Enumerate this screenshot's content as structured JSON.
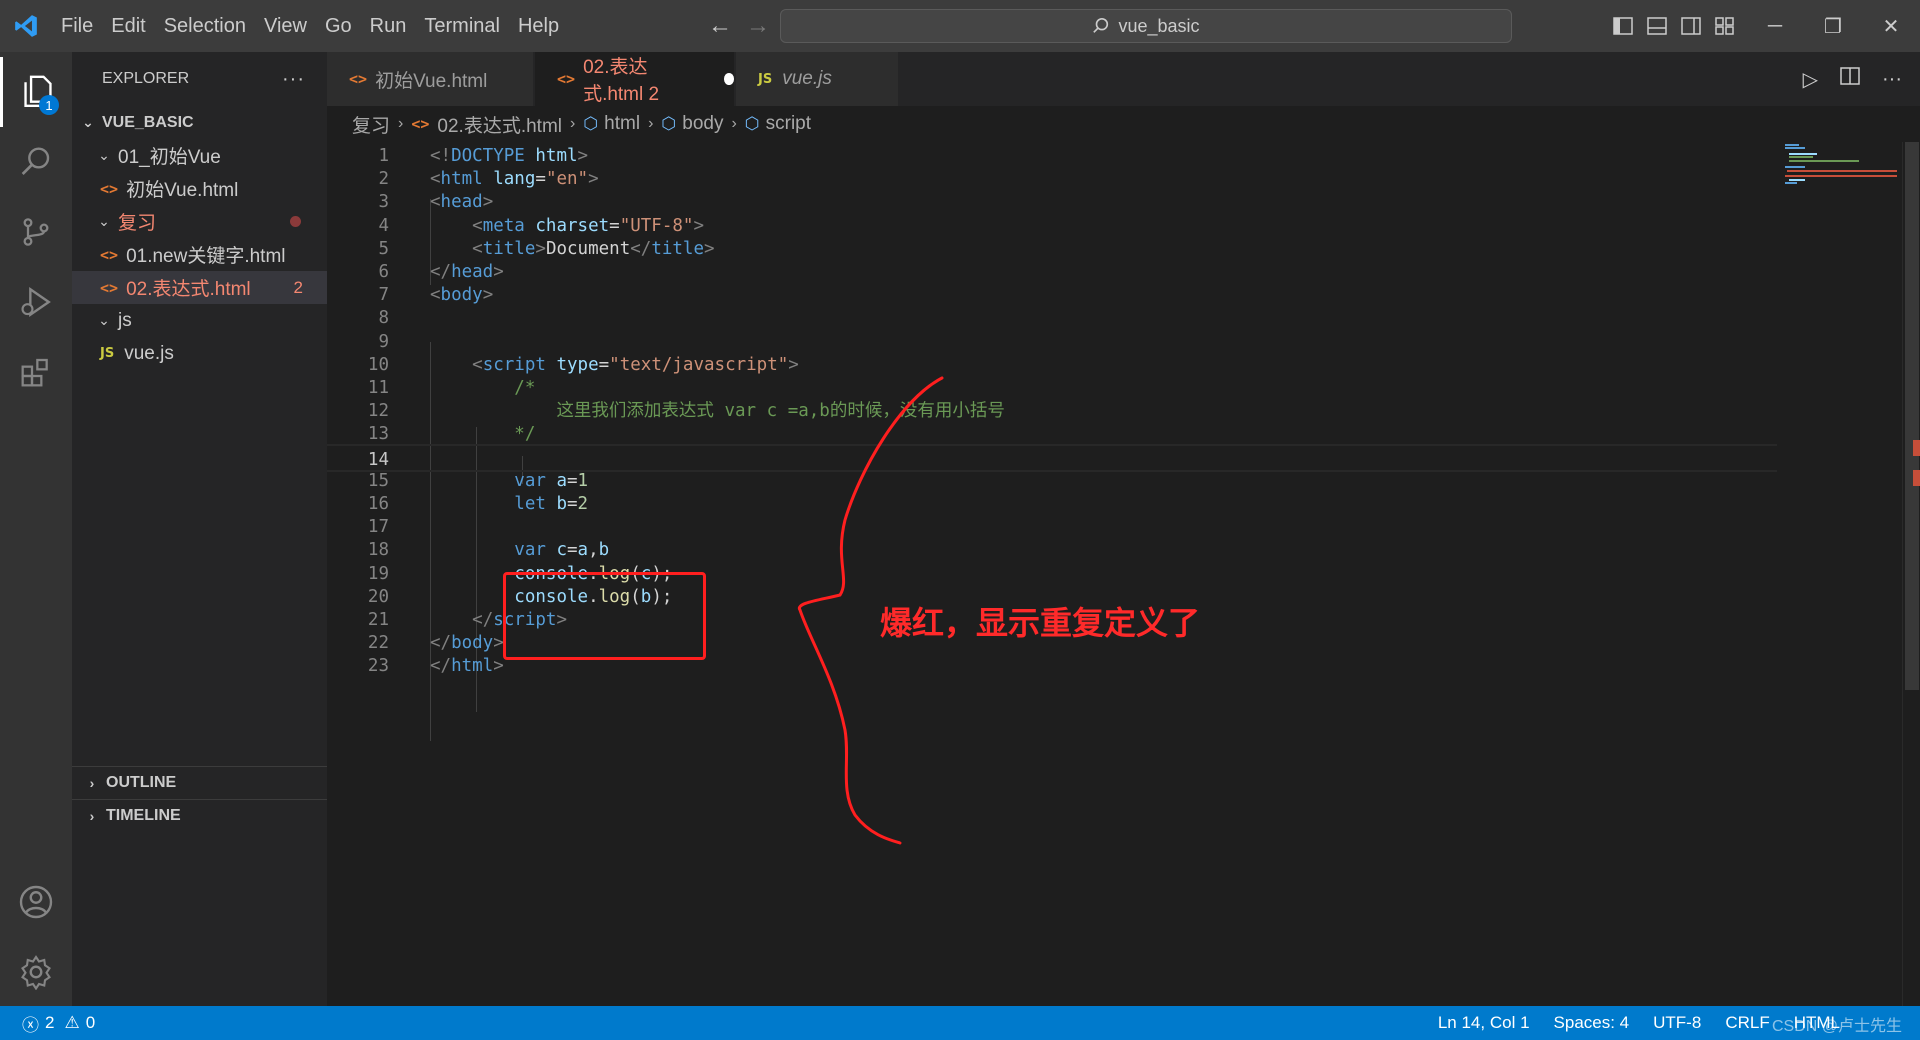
{
  "titlebar": {
    "menu": [
      "File",
      "Edit",
      "Selection",
      "View",
      "Go",
      "Run",
      "Terminal",
      "Help"
    ],
    "search_text": "vue_basic"
  },
  "activity": {
    "explorer_badge": "1"
  },
  "sidebar": {
    "title": "EXPLORER",
    "more": "···",
    "root": "VUE_BASIC",
    "tree": [
      {
        "label": "01_初始Vue",
        "kind": "folder",
        "depth": 1
      },
      {
        "label": "初始Vue.html",
        "kind": "html",
        "depth": 2
      },
      {
        "label": "复习",
        "kind": "folder",
        "depth": 1,
        "modified": true
      },
      {
        "label": "01.new关键字.html",
        "kind": "html",
        "depth": 2
      },
      {
        "label": "02.表达式.html",
        "kind": "html",
        "depth": 2,
        "errors": "2",
        "selected": true
      },
      {
        "label": "js",
        "kind": "folder",
        "depth": 1
      },
      {
        "label": "vue.js",
        "kind": "js",
        "depth": 2
      }
    ],
    "sections": [
      "OUTLINE",
      "TIMELINE"
    ]
  },
  "tabs": [
    {
      "label": "初始Vue.html",
      "icon": "html",
      "active": false
    },
    {
      "label": "02.表达式.html 2",
      "icon": "html",
      "active": true,
      "dirty": true
    },
    {
      "label": "vue.js",
      "icon": "js",
      "active": false
    }
  ],
  "breadcrumb": [
    "复习",
    "02.表达式.html",
    "html",
    "body",
    "script"
  ],
  "code": {
    "current_line": 14,
    "lines": [
      [
        [
          "t-br",
          "<!"
        ],
        [
          "t-tag",
          "DOCTYPE "
        ],
        [
          "t-attr",
          "html"
        ],
        [
          "t-br",
          ">"
        ]
      ],
      [
        [
          "t-br",
          "<"
        ],
        [
          "t-tag",
          "html "
        ],
        [
          "t-attr",
          "lang"
        ],
        [
          "t-plain",
          "="
        ],
        [
          "t-str",
          "\"en\""
        ],
        [
          "t-br",
          ">"
        ]
      ],
      [
        [
          "t-br",
          "<"
        ],
        [
          "t-tag",
          "head"
        ],
        [
          "t-br",
          ">"
        ]
      ],
      [
        [
          "t-plain",
          "    "
        ],
        [
          "t-br",
          "<"
        ],
        [
          "t-tag",
          "meta "
        ],
        [
          "t-attr",
          "charset"
        ],
        [
          "t-plain",
          "="
        ],
        [
          "t-str",
          "\"UTF-8\""
        ],
        [
          "t-br",
          ">"
        ]
      ],
      [
        [
          "t-plain",
          "    "
        ],
        [
          "t-br",
          "<"
        ],
        [
          "t-tag",
          "title"
        ],
        [
          "t-br",
          ">"
        ],
        [
          "t-plain",
          "Document"
        ],
        [
          "t-br",
          "</"
        ],
        [
          "t-tag",
          "title"
        ],
        [
          "t-br",
          ">"
        ]
      ],
      [
        [
          "t-br",
          "</"
        ],
        [
          "t-tag",
          "head"
        ],
        [
          "t-br",
          ">"
        ]
      ],
      [
        [
          "t-br",
          "<"
        ],
        [
          "t-tag",
          "body"
        ],
        [
          "t-br",
          ">"
        ]
      ],
      [],
      [],
      [
        [
          "t-plain",
          "    "
        ],
        [
          "t-br",
          "<"
        ],
        [
          "t-tag",
          "script "
        ],
        [
          "t-attr",
          "type"
        ],
        [
          "t-plain",
          "="
        ],
        [
          "t-str",
          "\"text/javascript\""
        ],
        [
          "t-br",
          ">"
        ]
      ],
      [
        [
          "t-plain",
          "        "
        ],
        [
          "t-com",
          "/*"
        ]
      ],
      [
        [
          "t-plain",
          "            "
        ],
        [
          "t-com",
          "这里我们添加表达式 var c =a,b的时候，没有用小括号"
        ]
      ],
      [
        [
          "t-plain",
          "        "
        ],
        [
          "t-com",
          "*/"
        ]
      ],
      [],
      [
        [
          "t-plain",
          "        "
        ],
        [
          "t-kw",
          "var "
        ],
        [
          "t-var",
          "a"
        ],
        [
          "t-plain",
          "="
        ],
        [
          "t-num",
          "1"
        ]
      ],
      [
        [
          "t-plain",
          "        "
        ],
        [
          "t-kw",
          "let "
        ],
        [
          "t-var",
          "b"
        ],
        [
          "t-plain",
          "="
        ],
        [
          "t-num",
          "2"
        ]
      ],
      [],
      [
        [
          "t-plain",
          "        "
        ],
        [
          "t-kw",
          "var "
        ],
        [
          "t-var",
          "c"
        ],
        [
          "t-plain",
          "="
        ],
        [
          "t-var",
          "a"
        ],
        [
          "t-plain",
          ","
        ],
        [
          "t-var",
          "b"
        ]
      ],
      [
        [
          "t-plain",
          "        "
        ],
        [
          "t-var",
          "console"
        ],
        [
          "t-plain",
          "."
        ],
        [
          "t-fn",
          "log"
        ],
        [
          "t-plain",
          "("
        ],
        [
          "t-var",
          "c"
        ],
        [
          "t-plain",
          ");"
        ]
      ],
      [
        [
          "t-plain",
          "        "
        ],
        [
          "t-var",
          "console"
        ],
        [
          "t-plain",
          "."
        ],
        [
          "t-fn",
          "log"
        ],
        [
          "t-plain",
          "("
        ],
        [
          "t-var",
          "b"
        ],
        [
          "t-plain",
          ");"
        ]
      ],
      [
        [
          "t-plain",
          "    "
        ],
        [
          "t-br",
          "</"
        ],
        [
          "t-tag",
          "script"
        ],
        [
          "t-br",
          ">"
        ]
      ],
      [
        [
          "t-br",
          "</"
        ],
        [
          "t-tag",
          "body"
        ],
        [
          "t-br",
          ">"
        ]
      ],
      [
        [
          "t-br",
          "</"
        ],
        [
          "t-tag",
          "html"
        ],
        [
          "t-br",
          ">"
        ]
      ]
    ]
  },
  "annotation": {
    "text": "爆红，显示重复定义了",
    "color": "#ff2a2a"
  },
  "statusbar": {
    "errors": "2",
    "warnings": "0",
    "position": "Ln 14, Col 1",
    "spaces": "Spaces: 4",
    "encoding": "UTF-8",
    "eol": "CRLF",
    "language": "HTML",
    "watermark": "CSDN @卢士先生"
  },
  "colors": {
    "accent": "#007acc",
    "error": "#f48771"
  }
}
